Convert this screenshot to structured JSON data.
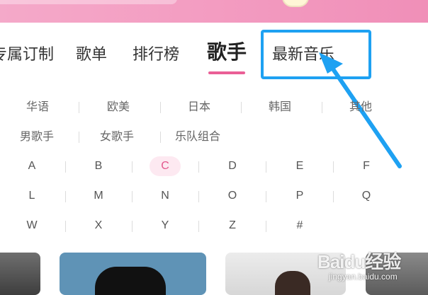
{
  "header": {
    "colors": {
      "band": "#f39cc1",
      "accent": "#ea5f96",
      "highlight": "#1ea1f2"
    }
  },
  "nav": {
    "tabs": [
      {
        "label": "专属订制"
      },
      {
        "label": "歌单"
      },
      {
        "label": "排行榜"
      },
      {
        "label": "歌手"
      },
      {
        "label": "最新音乐"
      }
    ],
    "active_tab": "歌手"
  },
  "filters": {
    "region": [
      "华语",
      "欧美",
      "日本",
      "韩国",
      "其他"
    ],
    "type": [
      "男歌手",
      "女歌手",
      "乐队组合"
    ],
    "letters": [
      [
        "A",
        "B",
        "C",
        "D",
        "E",
        "F"
      ],
      [
        "L",
        "M",
        "N",
        "O",
        "P",
        "Q"
      ],
      [
        "W",
        "X",
        "Y",
        "Z",
        "#"
      ]
    ],
    "selected_letter": "C"
  },
  "watermark": {
    "main": "Baidu经验",
    "sub": "jingyan.baidu.com"
  }
}
